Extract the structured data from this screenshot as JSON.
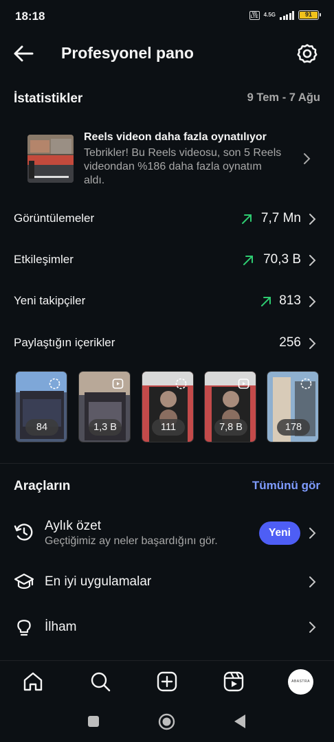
{
  "status_bar": {
    "time": "18:18",
    "network_label": "4.5G",
    "volte_label": "Vo LTE",
    "battery": "91",
    "battery_color": "#f1c21b"
  },
  "header": {
    "title": "Profesyonel pano",
    "back_icon": "arrow-left-icon",
    "settings_icon": "gear-icon"
  },
  "stats": {
    "title": "İstatistikler",
    "date_range": "9 Tem - 7 Ağu",
    "insight": {
      "title": "Reels videon daha fazla oynatılıyor",
      "body": "Tebrikler! Bu Reels videosu, son 5 Reels videondan %186 daha fazla oynatım aldı."
    },
    "metrics": [
      {
        "label": "Görüntülemeler",
        "value": "7,7 Mn",
        "trend": "up"
      },
      {
        "label": "Etkileşimler",
        "value": "70,3 B",
        "trend": "up"
      },
      {
        "label": "Yeni takipçiler",
        "value": "813",
        "trend": "up"
      },
      {
        "label": "Paylaştığın içerikler",
        "value": "256",
        "trend": "none"
      }
    ],
    "trend_color": "#2ecc71",
    "thumbnails": [
      {
        "count": "84",
        "icon": "reels-icon"
      },
      {
        "count": "1,3 B",
        "icon": "video-icon"
      },
      {
        "count": "111",
        "icon": "reels-icon"
      },
      {
        "count": "7,8 B",
        "icon": "video-icon"
      },
      {
        "count": "178",
        "icon": "reels-icon"
      }
    ]
  },
  "tools": {
    "title": "Araçların",
    "see_all": "Tümünü gör",
    "items": [
      {
        "label": "Aylık özet",
        "sub": "Geçtiğimiz ay neler başardığını gör.",
        "badge": "Yeni",
        "icon": "history-icon"
      },
      {
        "label": "En iyi uygulamalar",
        "sub": "",
        "badge": "",
        "icon": "graduation-cap-icon"
      },
      {
        "label": "İlham",
        "sub": "",
        "badge": "",
        "icon": "lightbulb-icon"
      }
    ]
  },
  "accent_color": "#4e5ef5",
  "link_color": "#7f9cff",
  "bottom_nav": {
    "items": [
      "home-icon",
      "search-icon",
      "create-icon",
      "reels-icon",
      "profile-avatar"
    ],
    "avatar_text": "ABASTRA"
  },
  "system_nav": [
    "recents-square-icon",
    "home-circle-icon",
    "back-triangle-icon"
  ]
}
